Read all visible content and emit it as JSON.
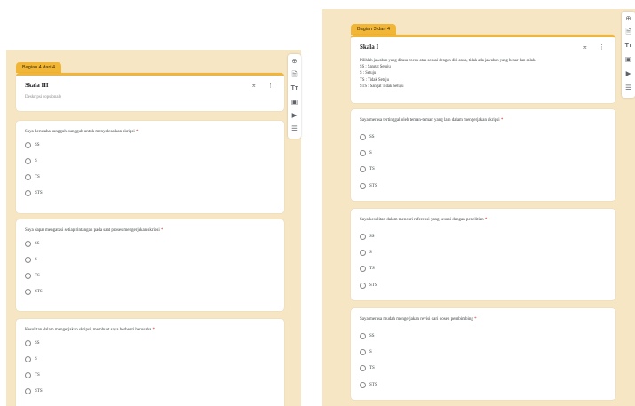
{
  "left_form": {
    "section_tab": "Bagian 4 dari 4",
    "header": {
      "title": "Skala III",
      "description_placeholder": "Deskripsi (opsional)"
    },
    "questions": [
      {
        "text": "Saya berusaha sungguh-sungguh untuk menyelesaikan skripsi",
        "required_mark": "*",
        "options": [
          "SS",
          "S",
          "TS",
          "STS"
        ]
      },
      {
        "text": "Saya dapat mengatasi setiap rintangan pada saat proses mengerjakan skripsi",
        "required_mark": "*",
        "options": [
          "SS",
          "S",
          "TS",
          "STS"
        ]
      },
      {
        "text": "Kesulitan dalam mengerjakan skripsi, membuat saya berhenti berusaha",
        "required_mark": "*",
        "options": [
          "SS",
          "S",
          "TS",
          "STS"
        ]
      }
    ]
  },
  "right_form": {
    "section_tab": "Bagian 3 dari 4",
    "header": {
      "title": "Skala I",
      "description_lines": [
        "Pilihlah jawaban yang dirasa cocok atau sesuai dengan diri anda, tidak ada jawaban yang benar dan salah.",
        "SS : Sangat Setuju",
        "S : Setuju",
        "TS : Tidak Setuju",
        "STS : Sangat Tidak Setuju"
      ]
    },
    "questions": [
      {
        "text": "Saya merasa tertinggal oleh teman-teman yang lain dalam mengerjakan skripsi",
        "required_mark": "*",
        "options": [
          "SS",
          "S",
          "TS",
          "STS"
        ]
      },
      {
        "text": "Saya kesulitan dalam mencari referensi yang sesuai dengan penelitian",
        "required_mark": "*",
        "options": [
          "SS",
          "S",
          "TS",
          "STS"
        ]
      },
      {
        "text": "Saya merasa mudah mengerjakan revisi dari dosen pembimbing",
        "required_mark": "*",
        "options": [
          "SS",
          "S",
          "TS",
          "STS"
        ]
      }
    ]
  },
  "icons": {
    "collapse": "collapse-icon",
    "more": "more-vert-icon",
    "toolbar": [
      "add-question-icon",
      "import-questions-icon",
      "add-title-icon",
      "add-image-icon",
      "add-video-icon",
      "add-section-icon"
    ],
    "toolbar_title_glyph": "Tт"
  },
  "colors": {
    "page_background": "#f7e6c4",
    "section_accent": "#f2b637",
    "required": "#d93025"
  }
}
